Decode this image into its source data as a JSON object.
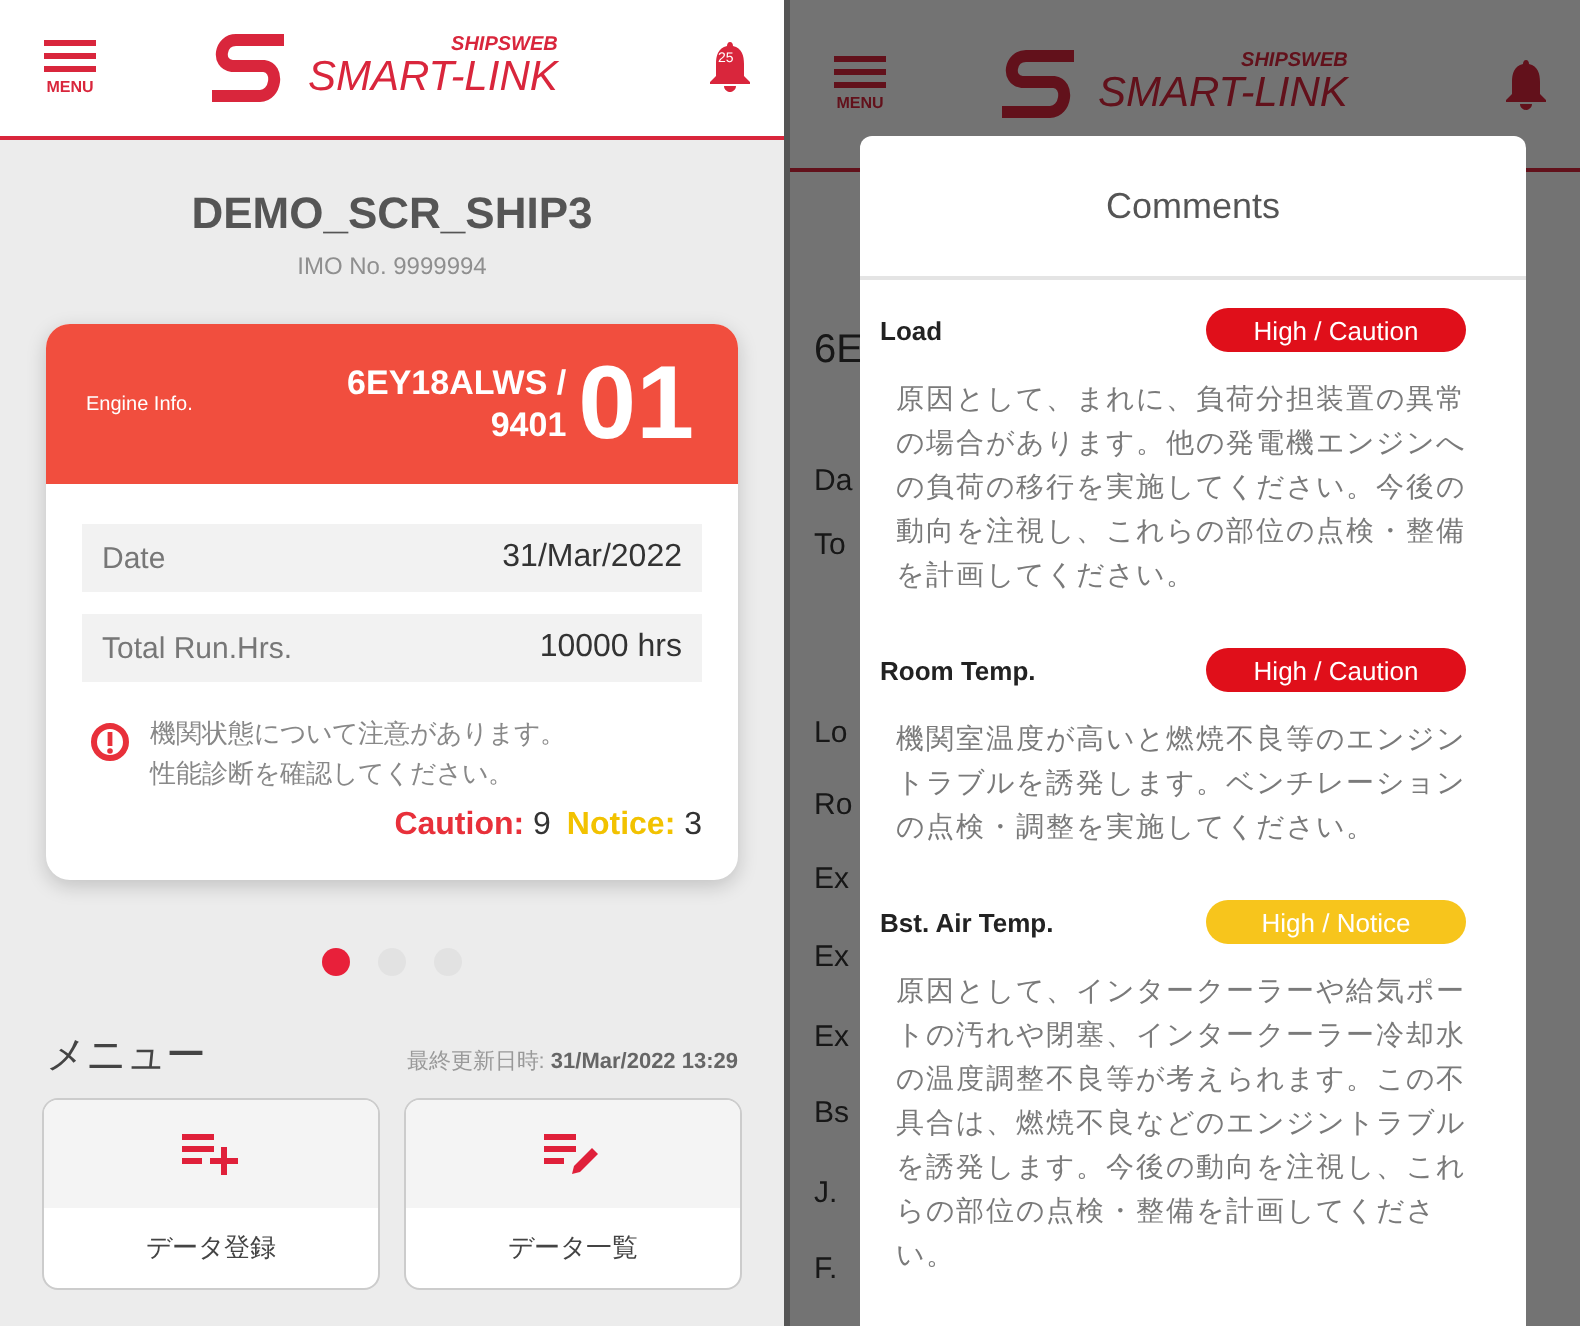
{
  "home": {
    "header": {
      "menu_label": "MENU",
      "brand_top": "SHIPSWEB",
      "brand_main": "SMART-LINK",
      "notification_count": "25"
    },
    "ship_name": "DEMO_SCR_SHIP3",
    "imo": "IMO No. 9999994",
    "engine_card": {
      "label": "Engine Info.",
      "model": "6EY18ALWS /",
      "serial": "9401",
      "number": "01",
      "rows": [
        {
          "label": "Date",
          "value": "31/Mar/2022"
        },
        {
          "label": "Total Run.Hrs.",
          "value": "10000 hrs"
        }
      ],
      "alert": "機関状態について注意があります。性能診断を確認してください。",
      "counts": [
        {
          "label": "Caution:",
          "value": "9",
          "kind": "caution"
        },
        {
          "label": "Notice:",
          "value": "3",
          "kind": "notice"
        }
      ]
    },
    "pager": [
      {
        "selected": true
      },
      {
        "selected": false
      },
      {
        "selected": false
      }
    ],
    "menu": {
      "title": "メニュー",
      "updated_label": "最終更新日時:",
      "updated_value": "31/Mar/2022 13:29",
      "buttons": [
        {
          "label": "データ登録",
          "kind": "add"
        },
        {
          "label": "データ一覧",
          "kind": "edit"
        }
      ]
    }
  },
  "comments_screen": {
    "header": {
      "menu_label": "MENU",
      "brand_top": "SHIPSWEB",
      "brand_main": "SMART-LINK"
    },
    "background_labels": [
      "6E",
      "Da",
      "To",
      "Lo",
      "Ro",
      "Ex",
      "Ex",
      "Ex",
      "Bs",
      "J.",
      "F."
    ],
    "modal": {
      "title": "Comments",
      "items": [
        {
          "label": "Load",
          "status": "High / Caution",
          "color": "#e00f1a",
          "text": "原因として、まれに、負荷分担装置の異常の場合があります。他の発電機エンジンへの負荷の移行を実施してください。今後の動向を注視し、これらの部位の点検・整備を計画してください。"
        },
        {
          "label": "Room Temp.",
          "status": "High / Caution",
          "color": "#e00f1a",
          "text": "機関室温度が高いと燃焼不良等のエンジントラブルを誘発します。ベンチレーションの点検・調整を実施してください。"
        },
        {
          "label": "Bst. Air Temp.",
          "status": "High / Notice",
          "color": "#f7c51c",
          "text": "原因として、インタークーラーや給気ポートの汚れや閉塞、インタークーラー冷却水の温度調整不良等が考えられます。この不具合は、燃焼不良などのエンジントラブルを誘発します。今後の動向を注視し、これらの部位の点検・整備を計画してください。"
        }
      ]
    }
  }
}
